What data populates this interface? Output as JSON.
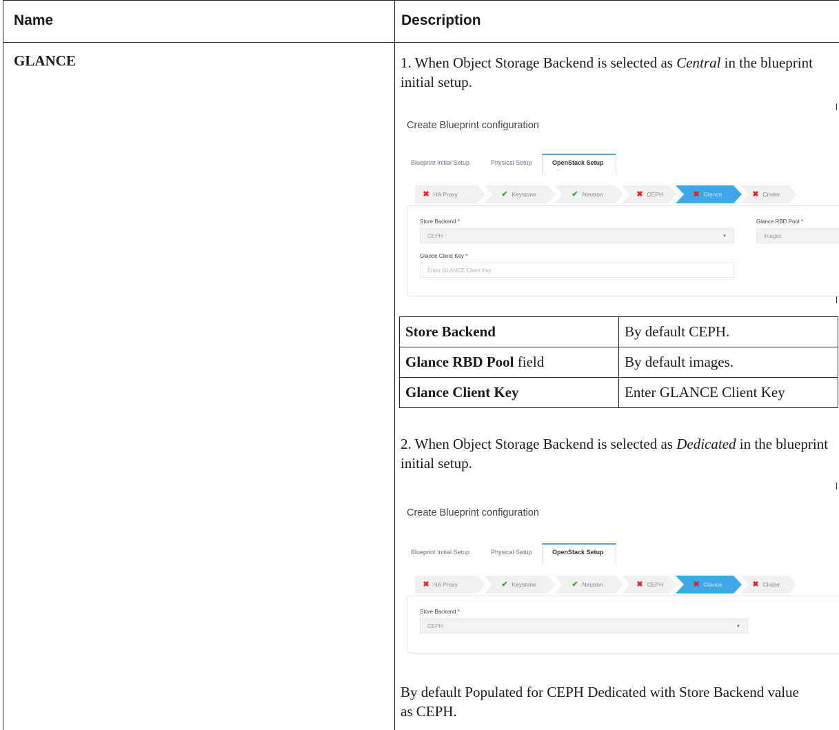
{
  "header": {
    "name_label": "Name",
    "description_label": "Description"
  },
  "row": {
    "name": "GLANCE",
    "para1": {
      "text_before": "1. When Object Storage Backend is selected as ",
      "emph": "Central",
      "text_after": " in the blueprint initial setup."
    },
    "para2": {
      "text_before": "2. When Object Storage Backend is selected as ",
      "emph": "Dedicated",
      "text_after": " in the blueprint initial setup."
    },
    "para3": "By default Populated for CEPH Dedicated with Store Backend value as CEPH."
  },
  "screenshot1": {
    "title": "Create Blueprint configuration",
    "tabs": [
      "Blueprint Initial Setup",
      "Physical Setup",
      "OpenStack Setup"
    ],
    "steps": [
      {
        "label": "HA Proxy",
        "status": "error"
      },
      {
        "label": "Keystone",
        "status": "ok"
      },
      {
        "label": "Neutron",
        "status": "ok"
      },
      {
        "label": "CEPH",
        "status": "error"
      },
      {
        "label": "Glance",
        "status": "error",
        "active": true
      },
      {
        "label": "Cinder",
        "status": "error"
      }
    ],
    "store_backend_label": "Store Backend",
    "store_backend_value": "CEPH",
    "rbd_pool_label": "Glance RBD Pool",
    "rbd_pool_value": "images",
    "client_key_label": "Glance Client Key",
    "client_key_placeholder": "Enter GLANCE Client Key",
    "required_mark": "*"
  },
  "field_table": [
    {
      "key": "Store Backend",
      "key_suffix": "",
      "value": "By default CEPH."
    },
    {
      "key": "Glance RBD Pool",
      "key_suffix": " field",
      "value": "By default images."
    },
    {
      "key": "Glance Client Key",
      "key_suffix": "",
      "value": "Enter GLANCE Client Key"
    }
  ],
  "screenshot2": {
    "title": "Create Blueprint configuration",
    "tabs": [
      "Blueprint Initial Setup",
      "Physical Setup",
      "OpenStack Setup"
    ],
    "steps": [
      {
        "label": "HA Proxy",
        "status": "error"
      },
      {
        "label": "Keystone",
        "status": "ok"
      },
      {
        "label": "Neutron",
        "status": "ok"
      },
      {
        "label": "CEPH",
        "status": "error"
      },
      {
        "label": "Glance",
        "status": "error",
        "active": true
      },
      {
        "label": "Cinder",
        "status": "error"
      }
    ],
    "store_backend_label": "Store Backend",
    "store_backend_value": "CEPH",
    "required_mark": "*"
  },
  "colors": {
    "active_step": "#3ea7e6",
    "error_icon": "#d9242b",
    "ok_icon": "#3aa03a",
    "tab_accent": "#4aa3df"
  },
  "icons": {
    "error": "x-icon",
    "ok": "check-icon",
    "select": "chevron-down-icon"
  }
}
